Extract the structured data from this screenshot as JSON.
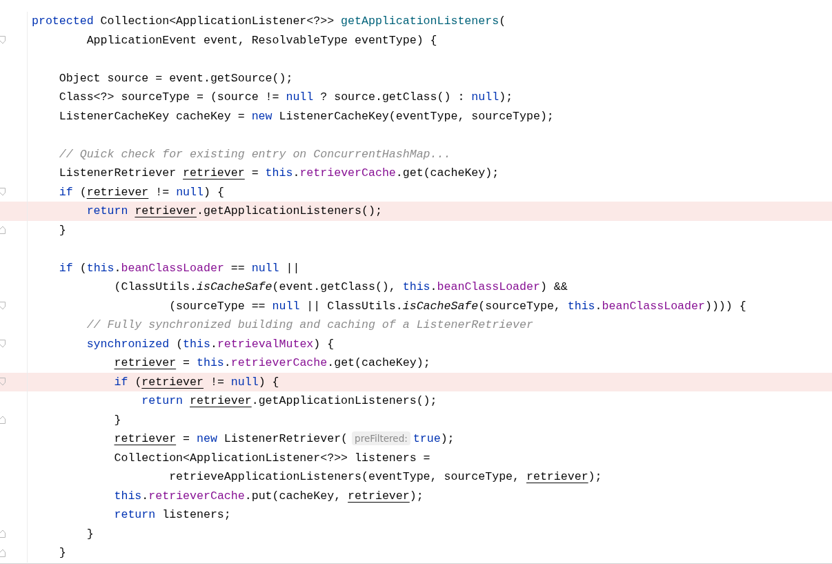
{
  "editor": {
    "lines": [
      {
        "kind": "code",
        "highlighted": false,
        "tokens": [
          {
            "kind": "kw",
            "text": "protected"
          },
          {
            "kind": "plain",
            "text": " Collection<ApplicationListener<?>> "
          },
          {
            "kind": "decl",
            "text": "getApplicationListeners"
          },
          {
            "kind": "plain",
            "text": "("
          }
        ]
      },
      {
        "kind": "code",
        "highlighted": false,
        "fold": {
          "kind": "start"
        },
        "tokens": [
          {
            "kind": "plain",
            "text": "        ApplicationEvent event, ResolvableType eventType) {"
          }
        ]
      },
      {
        "kind": "blank",
        "highlighted": false
      },
      {
        "kind": "code",
        "highlighted": false,
        "tokens": [
          {
            "kind": "plain",
            "text": "    Object source = event.getSource();"
          }
        ]
      },
      {
        "kind": "code",
        "highlighted": false,
        "tokens": [
          {
            "kind": "plain",
            "text": "    Class<?> sourceType = (source != "
          },
          {
            "kind": "kw",
            "text": "null"
          },
          {
            "kind": "plain",
            "text": " ? source.getClass() : "
          },
          {
            "kind": "kw",
            "text": "null"
          },
          {
            "kind": "plain",
            "text": ");"
          }
        ]
      },
      {
        "kind": "code",
        "highlighted": false,
        "tokens": [
          {
            "kind": "plain",
            "text": "    ListenerCacheKey cacheKey = "
          },
          {
            "kind": "kw",
            "text": "new"
          },
          {
            "kind": "plain",
            "text": " ListenerCacheKey(eventType, sourceType);"
          }
        ]
      },
      {
        "kind": "blank",
        "highlighted": false
      },
      {
        "kind": "code",
        "highlighted": false,
        "tokens": [
          {
            "kind": "comment",
            "text": "    // Quick check for existing entry on ConcurrentHashMap..."
          }
        ]
      },
      {
        "kind": "code",
        "highlighted": false,
        "tokens": [
          {
            "kind": "plain",
            "text": "    ListenerRetriever "
          },
          {
            "kind": "var",
            "text": "retriever"
          },
          {
            "kind": "plain",
            "text": " = "
          },
          {
            "kind": "kw",
            "text": "this"
          },
          {
            "kind": "plain",
            "text": "."
          },
          {
            "kind": "field",
            "text": "retrieverCache"
          },
          {
            "kind": "plain",
            "text": ".get(cacheKey);"
          }
        ]
      },
      {
        "kind": "code",
        "highlighted": false,
        "fold": {
          "kind": "start"
        },
        "tokens": [
          {
            "kind": "kw",
            "text": "    if"
          },
          {
            "kind": "plain",
            "text": " ("
          },
          {
            "kind": "var",
            "text": "retriever"
          },
          {
            "kind": "plain",
            "text": " != "
          },
          {
            "kind": "kw",
            "text": "null"
          },
          {
            "kind": "plain",
            "text": ") {"
          }
        ]
      },
      {
        "kind": "code",
        "highlighted": true,
        "tokens": [
          {
            "kind": "kw",
            "text": "        return"
          },
          {
            "kind": "var",
            "text": " retriever"
          },
          {
            "kind": "plain",
            "text": ".getApplicationListeners();"
          }
        ]
      },
      {
        "kind": "code",
        "highlighted": false,
        "fold": {
          "kind": "end"
        },
        "tokens": [
          {
            "kind": "plain",
            "text": "    }"
          }
        ]
      },
      {
        "kind": "blank",
        "highlighted": false
      },
      {
        "kind": "code",
        "highlighted": false,
        "tokens": [
          {
            "kind": "kw",
            "text": "    if"
          },
          {
            "kind": "plain",
            "text": " ("
          },
          {
            "kind": "kw",
            "text": "this"
          },
          {
            "kind": "plain",
            "text": "."
          },
          {
            "kind": "field",
            "text": "beanClassLoader"
          },
          {
            "kind": "plain",
            "text": " == "
          },
          {
            "kind": "kw",
            "text": "null"
          },
          {
            "kind": "plain",
            "text": " ||"
          }
        ]
      },
      {
        "kind": "code",
        "highlighted": false,
        "tokens": [
          {
            "kind": "plain",
            "text": "            (ClassUtils."
          },
          {
            "kind": "static",
            "text": "isCacheSafe"
          },
          {
            "kind": "plain",
            "text": "(event.getClass(), "
          },
          {
            "kind": "kw",
            "text": "this"
          },
          {
            "kind": "plain",
            "text": "."
          },
          {
            "kind": "field",
            "text": "beanClassLoader"
          },
          {
            "kind": "plain",
            "text": ") &&"
          }
        ]
      },
      {
        "kind": "code",
        "highlighted": false,
        "fold": {
          "kind": "start"
        },
        "tokens": [
          {
            "kind": "plain",
            "text": "                    (sourceType == "
          },
          {
            "kind": "kw",
            "text": "null"
          },
          {
            "kind": "plain",
            "text": " || ClassUtils."
          },
          {
            "kind": "static",
            "text": "isCacheSafe"
          },
          {
            "kind": "plain",
            "text": "(sourceType, "
          },
          {
            "kind": "kw",
            "text": "this"
          },
          {
            "kind": "plain",
            "text": "."
          },
          {
            "kind": "field",
            "text": "beanClassLoader"
          },
          {
            "kind": "plain",
            "text": ")))) {"
          }
        ]
      },
      {
        "kind": "code",
        "highlighted": false,
        "tokens": [
          {
            "kind": "comment",
            "text": "        // Fully synchronized building and caching of a ListenerRetriever"
          }
        ]
      },
      {
        "kind": "code",
        "highlighted": false,
        "fold": {
          "kind": "start"
        },
        "tokens": [
          {
            "kind": "kw",
            "text": "        synchronized"
          },
          {
            "kind": "plain",
            "text": " ("
          },
          {
            "kind": "kw",
            "text": "this"
          },
          {
            "kind": "plain",
            "text": "."
          },
          {
            "kind": "field",
            "text": "retrievalMutex"
          },
          {
            "kind": "plain",
            "text": ") {"
          }
        ]
      },
      {
        "kind": "code",
        "highlighted": false,
        "tokens": [
          {
            "kind": "var",
            "text": "            retriever"
          },
          {
            "kind": "plain",
            "text": " = "
          },
          {
            "kind": "kw",
            "text": "this"
          },
          {
            "kind": "plain",
            "text": "."
          },
          {
            "kind": "field",
            "text": "retrieverCache"
          },
          {
            "kind": "plain",
            "text": ".get(cacheKey);"
          }
        ]
      },
      {
        "kind": "code",
        "highlighted": true,
        "fold": {
          "kind": "start"
        },
        "tokens": [
          {
            "kind": "kw",
            "text": "            if"
          },
          {
            "kind": "plain",
            "text": " ("
          },
          {
            "kind": "var",
            "text": "retriever"
          },
          {
            "kind": "plain",
            "text": " != "
          },
          {
            "kind": "kw",
            "text": "null"
          },
          {
            "kind": "plain",
            "text": ") {"
          }
        ]
      },
      {
        "kind": "code",
        "highlighted": false,
        "tokens": [
          {
            "kind": "kw",
            "text": "                return"
          },
          {
            "kind": "var",
            "text": " retriever"
          },
          {
            "kind": "plain",
            "text": ".getApplicationListeners();"
          }
        ]
      },
      {
        "kind": "code",
        "highlighted": false,
        "fold": {
          "kind": "end"
        },
        "tokens": [
          {
            "kind": "plain",
            "text": "            }"
          }
        ]
      },
      {
        "kind": "code",
        "highlighted": false,
        "tokens": [
          {
            "kind": "var",
            "text": "            retriever"
          },
          {
            "kind": "plain",
            "text": " = "
          },
          {
            "kind": "kw",
            "text": "new"
          },
          {
            "kind": "plain",
            "text": " ListenerRetriever("
          },
          {
            "kind": "hint",
            "text": "preFiltered:"
          },
          {
            "kind": "kw",
            "text": "true"
          },
          {
            "kind": "plain",
            "text": ");"
          }
        ]
      },
      {
        "kind": "code",
        "highlighted": false,
        "tokens": [
          {
            "kind": "plain",
            "text": "            Collection<ApplicationListener<?>> listeners ="
          }
        ]
      },
      {
        "kind": "code",
        "highlighted": false,
        "tokens": [
          {
            "kind": "plain",
            "text": "                    retrieveApplicationListeners(eventType, sourceType, "
          },
          {
            "kind": "var",
            "text": "retriever"
          },
          {
            "kind": "plain",
            "text": ");"
          }
        ]
      },
      {
        "kind": "code",
        "highlighted": false,
        "tokens": [
          {
            "kind": "kw",
            "text": "            this"
          },
          {
            "kind": "plain",
            "text": "."
          },
          {
            "kind": "field",
            "text": "retrieverCache"
          },
          {
            "kind": "plain",
            "text": ".put(cacheKey, "
          },
          {
            "kind": "var",
            "text": "retriever"
          },
          {
            "kind": "plain",
            "text": ");"
          }
        ]
      },
      {
        "kind": "code",
        "highlighted": false,
        "tokens": [
          {
            "kind": "kw",
            "text": "            return"
          },
          {
            "kind": "plain",
            "text": " listeners;"
          }
        ]
      },
      {
        "kind": "code",
        "highlighted": false,
        "fold": {
          "kind": "end"
        },
        "tokens": [
          {
            "kind": "plain",
            "text": "        }"
          }
        ]
      },
      {
        "kind": "code",
        "highlighted": false,
        "fold": {
          "kind": "end"
        },
        "tokens": [
          {
            "kind": "plain",
            "text": "    }"
          }
        ]
      }
    ]
  }
}
